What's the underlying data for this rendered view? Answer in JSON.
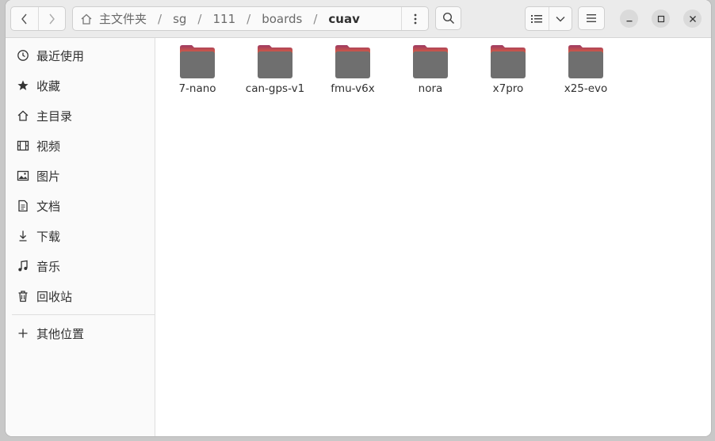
{
  "window": {
    "controls": {
      "minimize": "minimize",
      "maximize": "maximize",
      "close": "close"
    }
  },
  "header": {
    "path": [
      "主文件夹",
      "sg",
      "111",
      "boards",
      "cuav"
    ]
  },
  "sidebar": {
    "items": [
      {
        "label": "最近使用",
        "icon": "clock-icon"
      },
      {
        "label": "收藏",
        "icon": "star-icon"
      },
      {
        "label": "主目录",
        "icon": "home-icon"
      },
      {
        "label": "视频",
        "icon": "film-icon"
      },
      {
        "label": "图片",
        "icon": "image-icon"
      },
      {
        "label": "文档",
        "icon": "document-icon"
      },
      {
        "label": "下载",
        "icon": "download-icon"
      },
      {
        "label": "音乐",
        "icon": "music-icon"
      },
      {
        "label": "回收站",
        "icon": "trash-icon"
      }
    ],
    "other": {
      "label": "其他位置",
      "icon": "plus-icon"
    }
  },
  "files": [
    {
      "name": "7-nano"
    },
    {
      "name": "can-gps-v1"
    },
    {
      "name": "fmu-v6x"
    },
    {
      "name": "nora"
    },
    {
      "name": "x7pro"
    },
    {
      "name": "x25-evo"
    }
  ],
  "colors": {
    "folder_body": "#6f6f6f",
    "folder_tab_top": "#a03a5e",
    "folder_tab_bottom": "#e86a3a",
    "headerbar": "#ebebeb",
    "sidebar": "#fafafa"
  }
}
